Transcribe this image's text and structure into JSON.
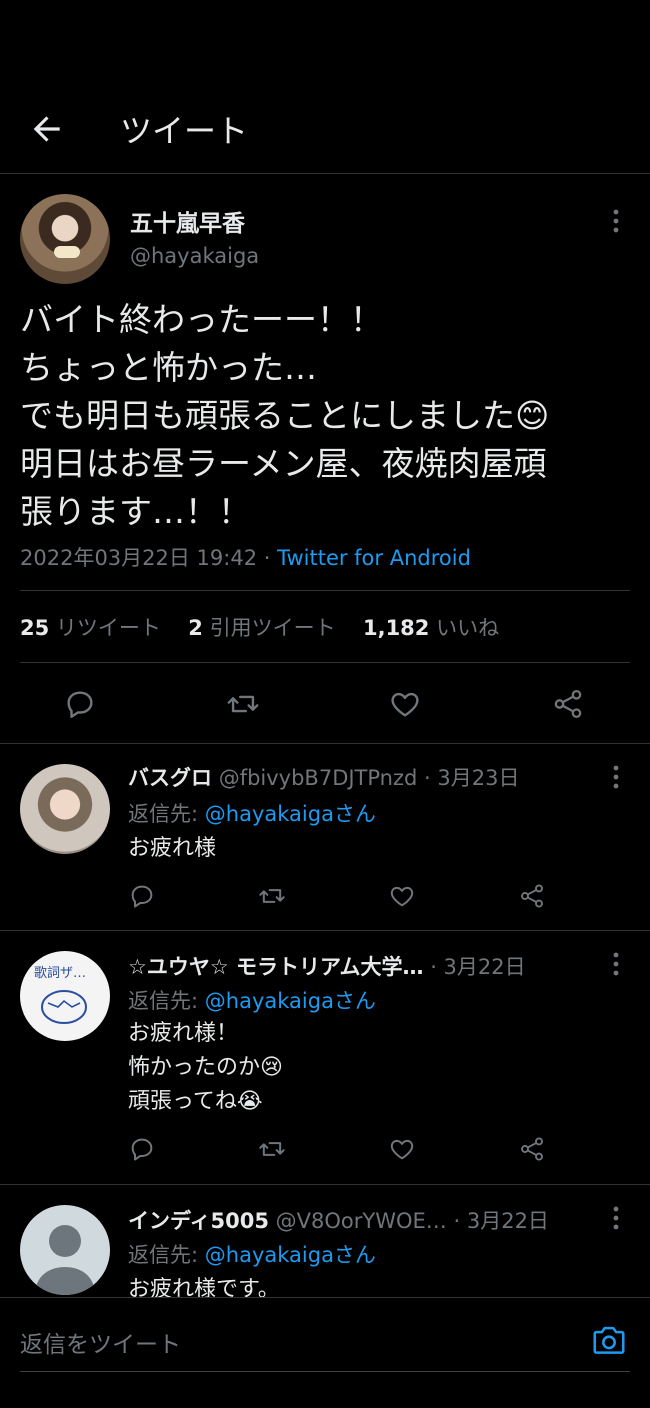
{
  "header": {
    "title": "ツイート"
  },
  "tweet": {
    "display_name": "五十嵐早香",
    "handle": "@hayakaiga",
    "text_lines": [
      "バイト終わったーー！！",
      "ちょっと怖かった…",
      "でも明日も頑張ることにしました😊",
      "明日はお昼ラーメン屋、夜焼肉屋頑",
      "張ります…！！"
    ],
    "timestamp": "2022年03月22日 19:42 · ",
    "source": "Twitter for Android",
    "stats": {
      "retweets_count": "25",
      "retweets_label": "リツイート",
      "quotes_count": "2",
      "quotes_label": "引用ツイート",
      "likes_count": "1,182",
      "likes_label": "いいね"
    }
  },
  "replies": [
    {
      "name": "バスグロ",
      "handle": "@fbivybB7DJTPnzd",
      "date": "· 3月23日",
      "reply_prefix": "返信先: ",
      "reply_to": "@hayakaigaさん",
      "text": "お疲れ様"
    },
    {
      "name": "☆ユウヤ☆ モラトリアム大学…",
      "handle": "",
      "date": "· 3月22日",
      "reply_prefix": "返信先: ",
      "reply_to": "@hayakaigaさん",
      "text": "お疲れ様！\n怖かったのか😢\n頑張ってね😭"
    },
    {
      "name": "インディ5005",
      "handle": "@V8OorYWOE…",
      "date": "· 3月22日",
      "reply_prefix": "返信先: ",
      "reply_to": "@hayakaigaさん",
      "text": "お疲れ様です。"
    }
  ],
  "composer": {
    "placeholder": "返信をツイート"
  },
  "colors": {
    "background": "#000000",
    "accent": "#1d9bf0",
    "secondary_text": "#71767b",
    "divider": "#2f3336"
  },
  "icons": [
    "back-arrow-icon",
    "more-icon",
    "reply-icon",
    "retweet-icon",
    "like-icon",
    "share-icon",
    "camera-icon"
  ]
}
